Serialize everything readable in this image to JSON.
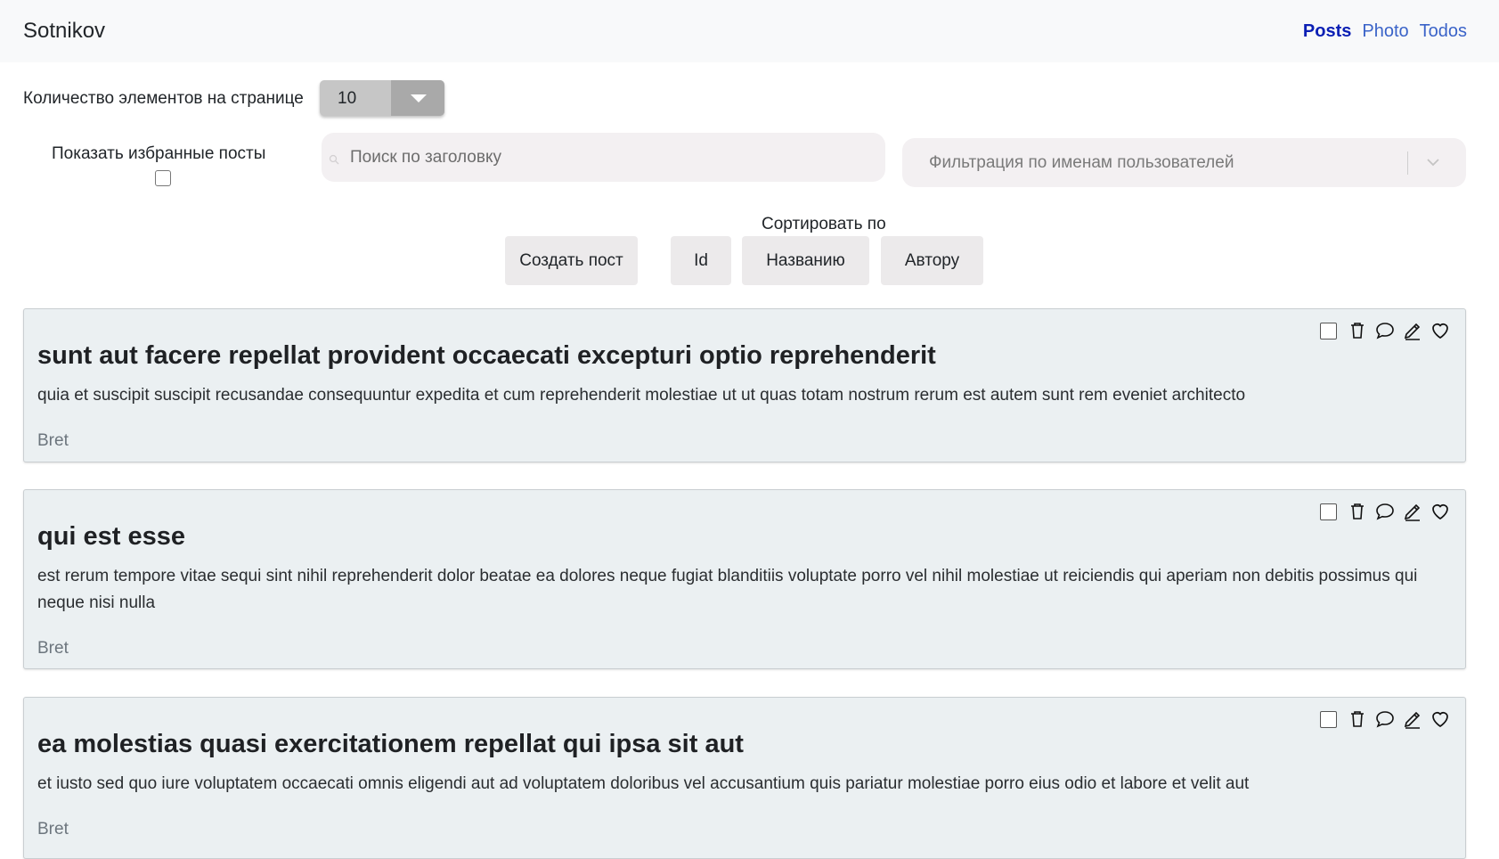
{
  "navbar": {
    "brand": "Sotnikov",
    "links": [
      {
        "label": "Posts",
        "active": true
      },
      {
        "label": "Photo",
        "active": false
      },
      {
        "label": "Todos",
        "active": false
      }
    ]
  },
  "controls": {
    "per_page_label": "Количество элементов на странице",
    "per_page_value": "10",
    "favorites_label": "Показать избранные посты",
    "search_placeholder": "Поиск по заголовку",
    "user_filter_placeholder": "Фильтрация по именам пользователей",
    "sort_label": "Сортировать по",
    "create_post": "Создать пост",
    "sort_id": "Id",
    "sort_title": "Названию",
    "sort_author": "Автору"
  },
  "posts": [
    {
      "title": "sunt aut facere repellat provident occaecati excepturi optio reprehenderit",
      "body": "quia et suscipit suscipit recusandae consequuntur expedita et cum reprehenderit molestiae ut ut quas totam nostrum rerum est autem sunt rem eveniet architecto",
      "author": "Bret"
    },
    {
      "title": "qui est esse",
      "body": "est rerum tempore vitae sequi sint nihil reprehenderit dolor beatae ea dolores neque fugiat blanditiis voluptate porro vel nihil molestiae ut reiciendis qui aperiam non debitis possimus qui neque nisi nulla",
      "author": "Bret"
    },
    {
      "title": "ea molestias quasi exercitationem repellat qui ipsa sit aut",
      "body": "et iusto sed quo iure voluptatem occaecati omnis eligendi aut ad voluptatem doloribus vel accusantium quis pariatur molestiae porro eius odio et labore et velit aut",
      "author": "Bret"
    }
  ],
  "colors": {
    "navbar_bg": "#f8f9fa",
    "link": "#3a63c8",
    "link_active": "#0b1fb4",
    "card_bg": "#ebf0f2"
  }
}
